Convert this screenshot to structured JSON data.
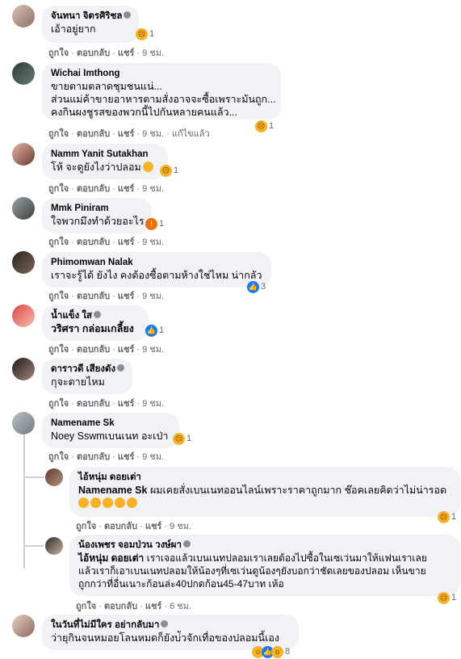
{
  "actions": {
    "like": "ถูกใจ",
    "reply": "ตอบกลับ",
    "share": "แชร์",
    "dot": "·",
    "edited": "แก้ไขแล้ว"
  },
  "comments": [
    {
      "name": "จันทนา จิตรศิริชล",
      "lines": [
        "เอ้าอยู่ยาก"
      ],
      "reaction_count": "1",
      "time": "9 ชม."
    },
    {
      "name": "Wichai Imthong",
      "lines": [
        "ขายตามตลาดชุมชนแน่...",
        "ส่วนแม่ค้าขายอาหารตามสั่งอาจจะซื้อเพราะมันถูก...",
        "คงกินผงชูรสของพวกนี้ไปกันหลายคนแล้ว..."
      ],
      "reaction_count": "1",
      "time": "9 ชม."
    },
    {
      "name": "Namm Yanit Sutakhan",
      "lines": [
        "โห้ จะดูยังไงว่าปลอม"
      ],
      "reaction_count": "1",
      "time": "9 ชม."
    },
    {
      "name": "Mmk Piniram",
      "lines": [
        "ใจพวกมึงทำด้วยอะไร"
      ],
      "reaction_count": "1",
      "time": "9 ชม."
    },
    {
      "name": "Phimomwan Nalak",
      "lines": [
        "เราจะรู้ได้ ยังไง คงต้องซื้อตามห้างใช่ไหม น่ากลัว"
      ],
      "reaction_count": "3",
      "time": "9 ชม."
    },
    {
      "name": "น้ำแข็ง ใส",
      "lines": [
        "วริศรา กล่อมเกลี้ยง"
      ],
      "reaction_count": "1",
      "time": "9 ชม."
    },
    {
      "name": "ดาราวดี เสียงดัง",
      "lines": [
        "กุจะตายไหม"
      ],
      "time": "9 ชม."
    },
    {
      "name": "Namename Sk",
      "lines": [
        "Noey Sswmเบนเนท อะเป่า"
      ],
      "reaction_count": "1",
      "time": "9 ชม."
    },
    {
      "name": "ไอ้หนุ่ม ดอยเต่า",
      "mention": "Namename Sk",
      "lines": [
        "ผมเคยสั่งเบนเนทออนไลน์เพราะราคาถูกมาก ช๊อคเลยคิดว่าไม่น่ารอด"
      ],
      "reaction_count": "1",
      "time": "9 ชม."
    },
    {
      "name": "น้องเพชร จอมป่วน วงษ์ผา",
      "mention": "ไอ้หนุ่ม ดอยเต่า",
      "lines": [
        "เราเจอแล้วเบนเนทปลอมเราเลยต้องไปซื้อในเซเว่นมาให้แฟนเราเลย",
        "แล้วเราก็เอาเบนเนทปลอมให้น้องๆที่เซเว่นดูน้องๆยังบอกว่าชัดเลยของปลอม เห็นขาย",
        "ถูกกว่าที่อื่นเนาะก้อนล่ะ40ปกดก้อน45-47บาท เห้อ"
      ],
      "reaction_count": "1",
      "time": "6 ชม."
    },
    {
      "name": "ในวันที่ไม่มีใคร อย่ากลับมา",
      "lines": [
        "ว่ายุกินจนหมอยโลนหมดก็ยังบ่ัวจักเทื่อของปลอมนี้เอง"
      ],
      "reaction_count": "8",
      "time": "9 ชม."
    }
  ],
  "colors": {
    "bubble": "#f0f2f5",
    "meta": "#65676b",
    "like": "#1877f2",
    "sad": "#f7b125"
  },
  "icons": [
    "sad-reaction-icon",
    "like-reaction-icon",
    "haha-reaction-icon",
    "wow-reaction-icon",
    "angry-reaction-icon",
    "verified-badge-icon"
  ]
}
